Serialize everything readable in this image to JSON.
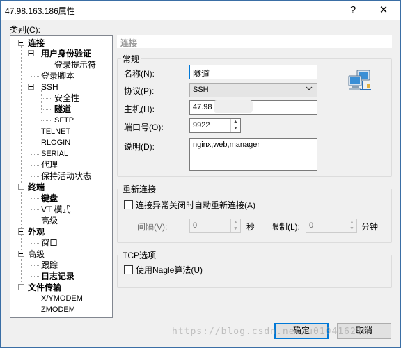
{
  "window": {
    "title": "47.98.163.186属性",
    "help_glyph": "?",
    "close_glyph": "✕"
  },
  "category_label": "类别(C):",
  "tree": {
    "connection": "连接",
    "user_auth": "用户身份验证",
    "login_prompt": "登录提示符",
    "login_script": "登录脚本",
    "ssh": "SSH",
    "security": "安全性",
    "tunnel": "隧道",
    "sftp": "SFTP",
    "telnet": "TELNET",
    "rlogin": "RLOGIN",
    "serial": "SERIAL",
    "proxy": "代理",
    "keepalive": "保持活动状态",
    "terminal": "终端",
    "keyboard": "键盘",
    "vt_mode": "VT 模式",
    "advanced_t": "高级",
    "appearance": "外观",
    "window": "窗口",
    "advanced": "高级",
    "trace": "跟踪",
    "logging": "日志记录",
    "file_transfer": "文件传输",
    "xymodem": "X/YMODEM",
    "zmodem": "ZMODEM"
  },
  "panel": {
    "header": "连接",
    "general": {
      "group_label": "常规",
      "name_label": "名称(N):",
      "name_value": "隧道",
      "protocol_label": "协议(P):",
      "protocol_value": "SSH",
      "host_label": "主机(H):",
      "host_value": "47.98",
      "port_label": "端口号(O):",
      "port_value": "9922",
      "desc_label": "说明(D):",
      "desc_value": "nginx,web,manager"
    },
    "reconnect": {
      "group_label": "重新连接",
      "auto_label": "连接异常关闭时自动重新连接(A)",
      "auto_checked": false,
      "interval_label": "间隔(V):",
      "interval_value": "0",
      "interval_unit": "秒",
      "limit_label": "限制(L):",
      "limit_value": "0",
      "limit_unit": "分钟"
    },
    "tcp": {
      "group_label": "TCP选项",
      "nagle_label": "使用Nagle算法(U)",
      "nagle_checked": false
    }
  },
  "buttons": {
    "ok": "确定",
    "cancel": "取消"
  },
  "watermark": "https://blog.csdn.net/u010416228",
  "colors": {
    "accent": "#0078d7",
    "window_bg": "#f0f0f0"
  }
}
